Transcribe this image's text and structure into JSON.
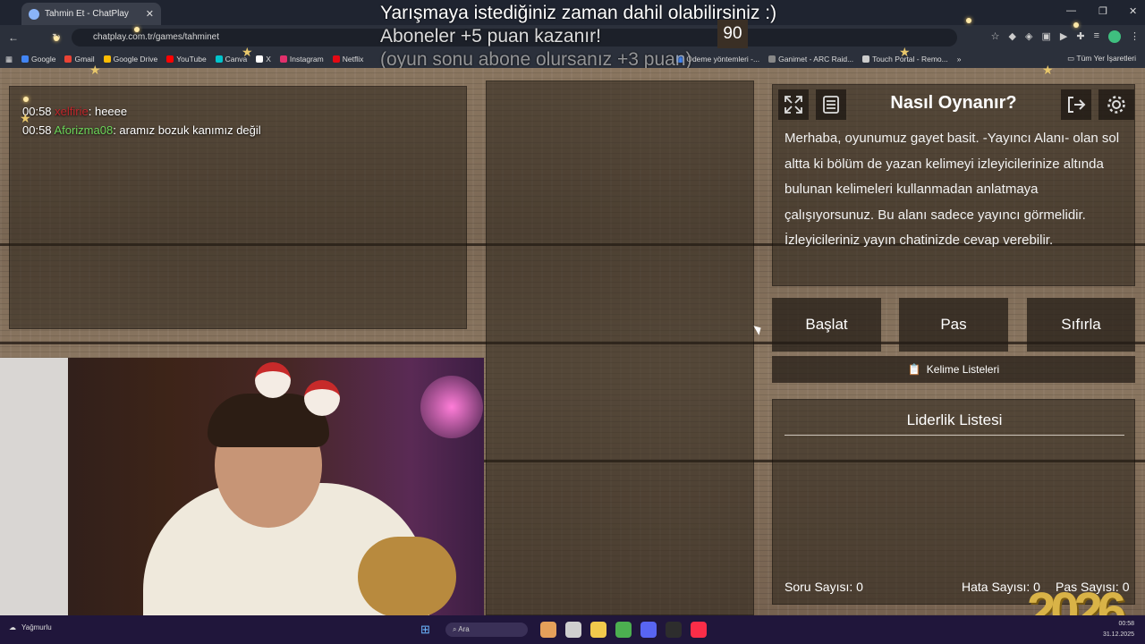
{
  "browser": {
    "tab_title": "Tahmin Et - ChatPlay",
    "tab_close": "✕",
    "url": "chatplay.com.tr/games/tahminet",
    "bookmarks": [
      {
        "label": "Google",
        "color": "#4285f4"
      },
      {
        "label": "Gmail",
        "color": "#ea4335"
      },
      {
        "label": "Google Drive",
        "color": "#fbbc04"
      },
      {
        "label": "YouTube",
        "color": "#ff0000"
      },
      {
        "label": "Canva",
        "color": "#00c4cc"
      },
      {
        "label": "X",
        "color": "#ffffff"
      },
      {
        "label": "Instagram",
        "color": "#e1306c"
      },
      {
        "label": "Netflix",
        "color": "#e50914"
      },
      {
        "label": "Ödeme yöntemleri -...",
        "color": "#4285f4"
      },
      {
        "label": "Ganimet - ARC Raid...",
        "color": "#888888"
      },
      {
        "label": "Touch Portal - Remo...",
        "color": "#cccccc"
      }
    ],
    "bookmarks_more": "»",
    "all_bookmarks": "Tüm Yer İşaretleri"
  },
  "overlay": {
    "line1": "Yarışmaya istediğiniz zaman dahil olabilirsiniz :)",
    "line2": "Aboneler +5 puan kazanır!",
    "line3": "(oyun sonu abone olursanız +3 puan)"
  },
  "chat": {
    "messages": [
      {
        "time": "00:58",
        "user": "xelfirie",
        "text": ": heeee"
      },
      {
        "time": "00:58",
        "user": "Aforizma08",
        "text": ": aramız bozuk kanımız değil"
      }
    ]
  },
  "game": {
    "timer": "90",
    "how_title": "Nasıl Oynanır?",
    "how_text": "Merhaba, oyunumuz gayet basit. -Yayıncı Alanı- olan sol altta ki bölüm de yazan kelimeyi izleyicilerinize altında bulunan kelimeleri kullanmadan anlatmaya çalışıyorsunuz. Bu alanı sadece yayıncı görmelidir. İzleyicileriniz yayın chatinizde cevap verebilir.",
    "buttons": {
      "start": "Başlat",
      "pass": "Pas",
      "reset": "Sıfırla"
    },
    "word_lists": "Kelime Listeleri",
    "leaderboard_title": "Liderlik Listesi",
    "stats": {
      "questions": "Soru Sayısı: 0",
      "errors": "Hata Sayısı: 0",
      "passes": "Pas Sayısı: 0"
    }
  },
  "taskbar": {
    "weather": "Yağmurlu",
    "search": "Ara",
    "date": "31.12.2025",
    "time": "00:58"
  },
  "decor": {
    "year": "2026"
  }
}
